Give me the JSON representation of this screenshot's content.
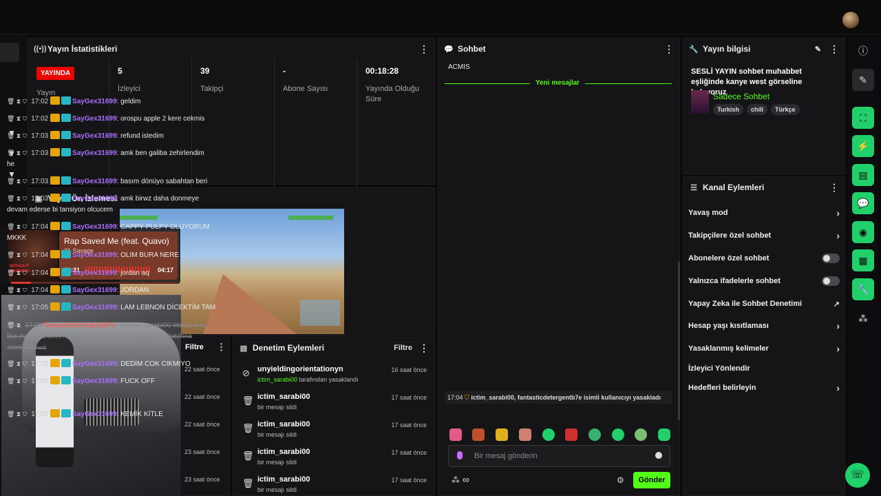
{
  "stats_panel": {
    "title": "Yayın İstatistikleri",
    "live_badge": "YAYINDA",
    "items": [
      {
        "value": "",
        "label": "Yayın"
      },
      {
        "value": "5",
        "label": "İzleyici"
      },
      {
        "value": "39",
        "label": "Takipçi"
      },
      {
        "value": "-",
        "label": "Abone Sayısı"
      },
      {
        "value": "00:18:28",
        "label": "Yayında Olduğu Süre"
      }
    ]
  },
  "preview_panel": {
    "title": "Yayın Ön İzlemesi"
  },
  "music": {
    "title": "Rap Saved Me (feat. Quavo)",
    "artist": "21 Savage",
    "elapsed": "00:31",
    "total": "04:17",
    "progress": 0.12,
    "art_text": "WITHOUT WARNING"
  },
  "filter_panel": {
    "label": "Filtre",
    "rows": [
      "22 saat önce",
      "22 saat önce",
      "22 saat önce",
      "23 saat önce",
      "23 saat önce"
    ]
  },
  "mod_panel": {
    "title": "Denetim Eylemleri",
    "filter_label": "Filtre",
    "rows": [
      {
        "user": "unyieldingorientationyn",
        "detail_user": "ictim_sarabi00",
        "detail": "tarafından yasaklandı",
        "time": "16 saat önce"
      },
      {
        "user": "ictim_sarabi00",
        "detail": "bir mesajı sildi",
        "time": "17 saat önce"
      },
      {
        "user": "ictim_sarabi00",
        "detail": "bir mesajı sildi",
        "time": "17 saat önce"
      },
      {
        "user": "ictim_sarabi00",
        "detail": "bir mesajı sildi",
        "time": "17 saat önce"
      },
      {
        "user": "ictim_sarabi00",
        "detail": "bir mesajı sildi",
        "time": "17 saat önce"
      }
    ]
  },
  "chat": {
    "title": "Sohbet",
    "top_cut": "ACMIS",
    "new_messages": "Yeni mesajlar",
    "user": "SayGex31699",
    "messages": [
      {
        "time": "17:02",
        "text": ": geldim"
      },
      {
        "time": "17:02",
        "text": ": orospu apple 2 kere cekmis"
      },
      {
        "time": "17:03",
        "text": ": refund istedim"
      },
      {
        "time": "17:03",
        "text": ": amk ben galiba zehirlendim",
        "cont": "he"
      },
      {
        "time": "17:03",
        "text": ": basım dönüyo sabahtan beri"
      },
      {
        "time": "17:03",
        "text": ": amk birwz daha donmeye",
        "cont": "devam ederse bi tansiyon olcucem"
      },
      {
        "time": "17:04",
        "text": ": CAPPY PULPY OLUYORUM",
        "cont": "MKKK"
      },
      {
        "time": "17:04",
        "text": ": OLIM BURA NERE"
      },
      {
        "time": "17:04",
        "text": ": jordan aq"
      },
      {
        "time": "17:04",
        "text": ": JORDAN"
      },
      {
        "time": "17:05",
        "text": ": LAM LEBNON DİCEKTİM TAM"
      }
    ],
    "banned": {
      "time": "17:05",
      "user": "fantasticdetergentb7e",
      "text": ": @ictim_sarabi00 Would you",
      "cont1": "like many viewers? Let's make you popular — https://nezhna",
      "cont2": ".com",
      "tag": "(Banned)"
    },
    "messages2": [
      {
        "time": "17:05",
        "text": ": DEDİM COK CIKMIYO"
      },
      {
        "time": "17:05",
        "text": ": FUCK OFF"
      }
    ],
    "notice": {
      "time": "17:04",
      "text": "ictim_sarabi00, fantasticdetergentb7e isimli kullanıcıyı yasakladı"
    },
    "last": {
      "time": "17:05",
      "text": ": KEMİK KİTLE"
    },
    "input_placeholder": "Bir mesaj gönderin",
    "send": "Gönder",
    "infinity": "∞"
  },
  "info": {
    "title": "Yayın bilgisi",
    "stream_title": "SESLİ YAYIN sohbet muhabbet eşliğinde kanye west görseline bakıyoruz",
    "category": "Sadece Sohbet",
    "tags": [
      "Turkish",
      "chill",
      "Türkçe"
    ]
  },
  "channel_actions": {
    "title": "Kanal Eylemleri",
    "items": [
      {
        "label": "Yavaş mod",
        "kind": "chevron"
      },
      {
        "label": "Takipçilere özel sohbet",
        "kind": "chevron"
      },
      {
        "label": "Abonelere özel sohbet",
        "kind": "toggle"
      },
      {
        "label": "Yalnızca ifadelerle sohbet",
        "kind": "toggle"
      },
      {
        "label": "Yapay Zeka ile Sohbet Denetimi",
        "kind": "external"
      },
      {
        "label": "Hesap yaşı kısıtlaması",
        "kind": "chevron"
      },
      {
        "label": "Yasaklanmış kelimeler",
        "kind": "chevron"
      },
      {
        "label": "İzleyici Yönlendir",
        "kind": "none"
      },
      {
        "label": "Hedefleri belirleyin",
        "kind": "chevron"
      }
    ]
  },
  "colors": {
    "accent": "#53fc18",
    "live": "#eb0400",
    "username": "#a970ff",
    "banned": "#ff5a4e"
  }
}
